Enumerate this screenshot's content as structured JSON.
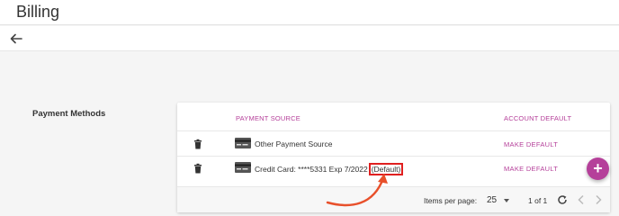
{
  "header": {
    "title": "Billing"
  },
  "nav": {
    "back_icon": "arrow-left-icon"
  },
  "section": {
    "label": "Payment Methods"
  },
  "table": {
    "columns": {
      "source": "PAYMENT SOURCE",
      "account_default": "ACCOUNT DEFAULT"
    },
    "rows": [
      {
        "source": "Other Payment Source",
        "action": "MAKE DEFAULT",
        "icon": "card-icon"
      },
      {
        "source": "Credit Card: ****5331 Exp 7/2022",
        "badge": "(Default)",
        "action": "MAKE DEFAULT",
        "icon": "card-icon"
      }
    ]
  },
  "pagination": {
    "items_per_page_label": "Items per page:",
    "items_per_page_value": "25",
    "range_label": "1 of 1"
  },
  "colors": {
    "accent": "#b5409a",
    "highlight": "#e02020"
  }
}
